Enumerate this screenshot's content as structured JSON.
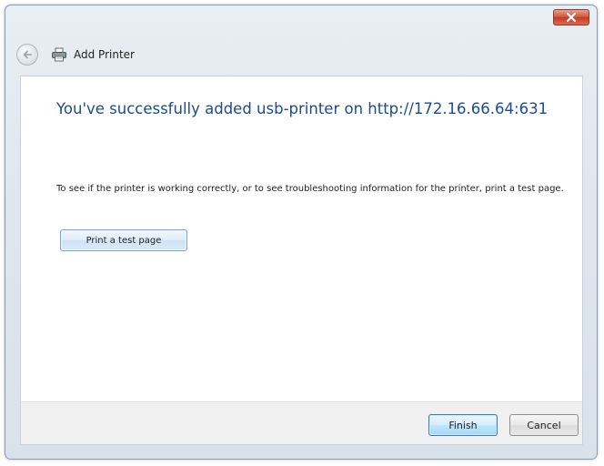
{
  "window": {
    "title": "Add Printer",
    "close_icon": "close-icon"
  },
  "nav": {
    "back_icon": "back-arrow-icon",
    "title_icon": "printer-icon"
  },
  "main": {
    "headline": "You've successfully added usb-printer on http://172.16.66.64:631",
    "instructions": "To see if the printer is working correctly, or to see troubleshooting information for the printer, print a test page.",
    "test_page_button": "Print a test page"
  },
  "footer": {
    "finish_label": "Finish",
    "cancel_label": "Cancel"
  },
  "colors": {
    "headline": "#1a4c8a",
    "close_button": "#c73b22",
    "frame": "#dfe6ee"
  }
}
